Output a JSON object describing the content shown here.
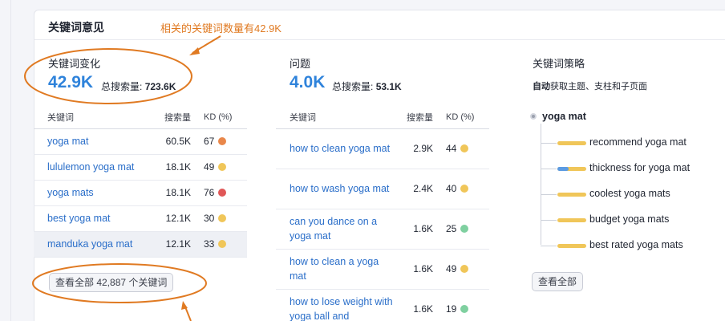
{
  "card": {
    "title": "关键词意见"
  },
  "annotation": {
    "text": "相关的关键词数量有42.9K"
  },
  "variations": {
    "label": "关键词变化",
    "count": "42.9K",
    "volume_label": "总搜索量:",
    "volume": "723.6K",
    "headers": {
      "keyword": "关键词",
      "volume": "搜索量",
      "kd": "KD (%)"
    },
    "rows": [
      {
        "keyword": "yoga mat",
        "volume": "60.5K",
        "kd": "67",
        "kd_color": "#e9874a"
      },
      {
        "keyword": "lululemon yoga mat",
        "volume": "18.1K",
        "kd": "49",
        "kd_color": "#f0c659"
      },
      {
        "keyword": "yoga mats",
        "volume": "18.1K",
        "kd": "76",
        "kd_color": "#e05757"
      },
      {
        "keyword": "best yoga mat",
        "volume": "12.1K",
        "kd": "30",
        "kd_color": "#f0c659"
      },
      {
        "keyword": "manduka yoga mat",
        "volume": "12.1K",
        "kd": "33",
        "kd_color": "#f0c659"
      }
    ],
    "view_all": "查看全部 42,887 个关键词"
  },
  "questions": {
    "label": "问题",
    "count": "4.0K",
    "volume_label": "总搜索量:",
    "volume": "53.1K",
    "headers": {
      "keyword": "关键词",
      "volume": "搜索量",
      "kd": "KD (%)"
    },
    "rows": [
      {
        "keyword": "how to clean yoga mat",
        "volume": "2.9K",
        "kd": "44",
        "kd_color": "#f0c659"
      },
      {
        "keyword": "how to wash yoga mat",
        "volume": "2.4K",
        "kd": "40",
        "kd_color": "#f0c659"
      },
      {
        "keyword": "can you dance on a yoga mat",
        "volume": "1.6K",
        "kd": "25",
        "kd_color": "#7fd0a0"
      },
      {
        "keyword": "how to clean a yoga mat",
        "volume": "1.6K",
        "kd": "49",
        "kd_color": "#f0c659"
      },
      {
        "keyword": "how to lose weight with yoga ball and",
        "volume": "1.6K",
        "kd": "19",
        "kd_color": "#7fd0a0"
      }
    ]
  },
  "strategy": {
    "label": "关键词策略",
    "sub_bold": "自动",
    "sub_rest": "获取主题、支柱和子页面",
    "root": "yoga mat",
    "branches": [
      {
        "label": "recommend yoga mat",
        "bar": "#f0c659",
        "bar2": ""
      },
      {
        "label": "thickness for yoga mat",
        "bar": "#f0c659",
        "bar2": "#5b9be3"
      },
      {
        "label": "coolest yoga mats",
        "bar": "#f0c659",
        "bar2": ""
      },
      {
        "label": "budget yoga mats",
        "bar": "#f0c659",
        "bar2": ""
      },
      {
        "label": "best rated yoga mats",
        "bar": "#f0c659",
        "bar2": ""
      }
    ],
    "view_all": "查看全部"
  }
}
